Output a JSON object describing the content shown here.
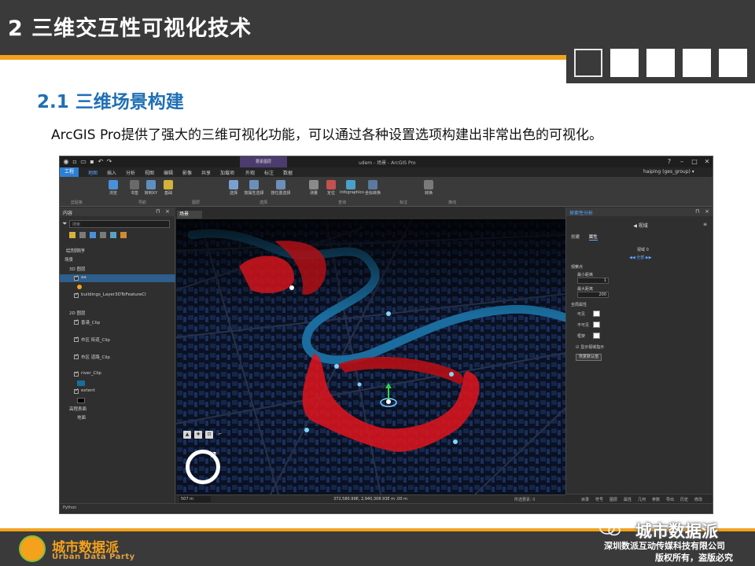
{
  "slide": {
    "title": "2 三维交互性可视化技术",
    "section": "2.1 三维场景构建",
    "description": "ArcGIS Pro提供了强大的三维可视化功能，可以通过各种设置选项构建出非常出色的可视化。"
  },
  "app": {
    "window_title": "udem - 场景 - ArcGIS Pro",
    "context_tab_header": "要素图层",
    "user": "haiping (ges_group) ▾",
    "ribbon_tabs": [
      "工程",
      "地图",
      "插入",
      "分析",
      "视图",
      "编辑",
      "影像",
      "共享",
      "加载项",
      "外观",
      "标注",
      "数据"
    ],
    "ribbon_buttons": [
      "浏览",
      "书签",
      "转到XY",
      "基础",
      "选择",
      "按属性选择",
      "按位置选择",
      "测量",
      "定位",
      "Infographics",
      "坐标转换",
      "转换"
    ],
    "ribbon_groups": [
      "剪贴板",
      "导航",
      "图层",
      "选择",
      "查询",
      "标注",
      "离线"
    ],
    "contents": {
      "title": "内容",
      "search_placeholder": "搜索",
      "drawing_order_label": "绘制顺序",
      "layers": [
        "场景",
        "3D 图层",
        "aa",
        "buildings_Layer3DToFeatureCl",
        "2D 图层",
        "香港_Clip",
        "市区 街道_Clip",
        "市区 道路_Clip",
        "river_Clip",
        "extent",
        "高程表面",
        "地面"
      ]
    },
    "view_tab": "场景",
    "status": {
      "scale": "507 m",
      "coordinates": "372,580.99E, 2,940,308.93E m   .00 m",
      "selected": "所选要素: 0"
    },
    "python_label": "Python",
    "explore": {
      "title": "探索性分析",
      "nav_label": "视域",
      "tabs": [
        "创建",
        "属性"
      ],
      "observer_label": "观察点",
      "count_label": "视域 0",
      "all_label": "全部",
      "min_distance_label": "最小距离",
      "min_distance_value": "1",
      "max_distance_label": "最大距离",
      "max_distance_value": "200",
      "display_label": "全局属性",
      "visible_label": "可见",
      "invisible_label": "不可见",
      "frame_label": "框架",
      "checkbox_label": "显示视域指示",
      "reset_button": "恢复默认值",
      "bottom_tabs": [
        "目录",
        "符号",
        "图层",
        "属性",
        "几何",
        "参数",
        "导出",
        "历史",
        "修改"
      ]
    }
  },
  "footer": {
    "brand_cn": "城市数据派",
    "brand_en": "Urban Data Party",
    "wechat_name": "城市数据派",
    "company": "深圳数派互动传媒科技有限公司",
    "copyright": "版权所有，盗版必究"
  },
  "colors": {
    "header": "#3a3a3a",
    "accent_orange": "#f4a11c",
    "section_blue": "#1f6fb4",
    "viewshed_red": "#e0141c",
    "river_blue": "#1a6d9e"
  }
}
